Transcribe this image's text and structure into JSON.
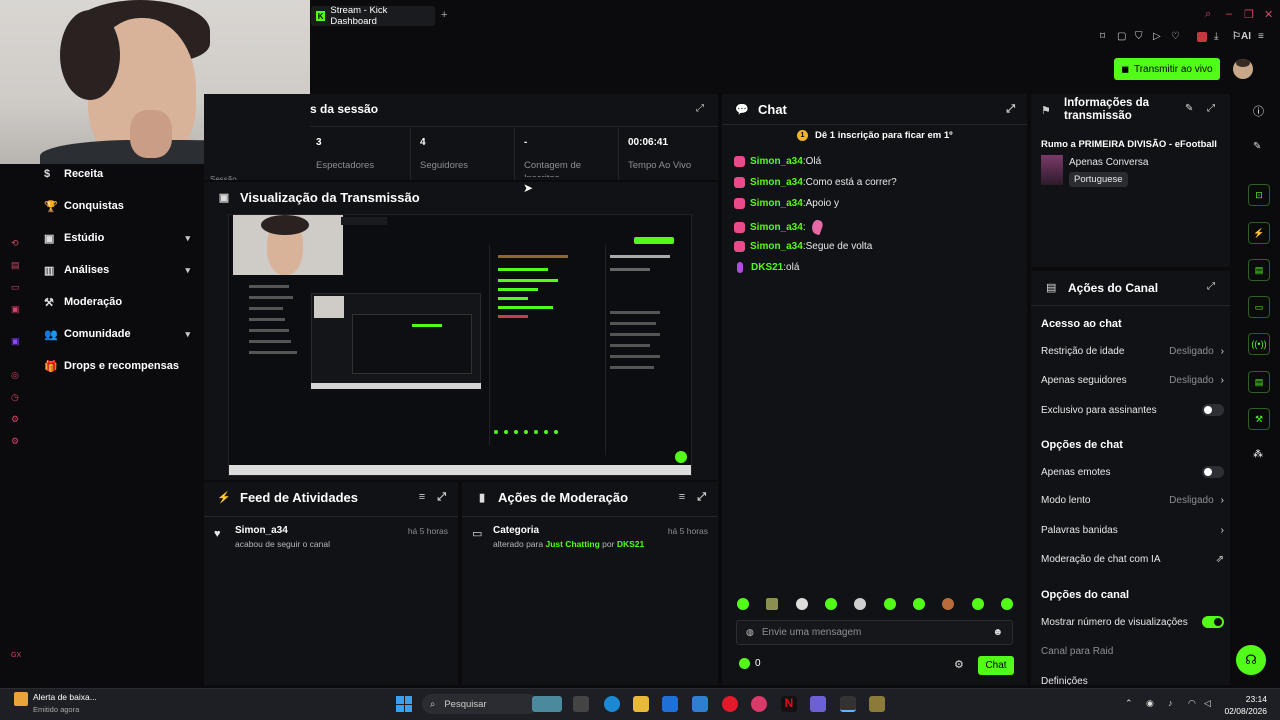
{
  "browser": {
    "tab_title": "Stream - Kick Dashboard",
    "tab_logo": "K",
    "new_tab_icon": "+"
  },
  "header": {
    "go_live_label": "Transmitir ao vivo",
    "ai_label": "AI"
  },
  "nav": {
    "items": [
      {
        "label": "Receita",
        "icon": "receipt-icon",
        "glyph": "$",
        "chev": ""
      },
      {
        "label": "Conquistas",
        "icon": "trophy-icon",
        "glyph": "🏆",
        "chev": ""
      },
      {
        "label": "Estúdio",
        "icon": "studio-icon",
        "glyph": "▣",
        "chev": "▾"
      },
      {
        "label": "Análises",
        "icon": "chart-icon",
        "glyph": "▥",
        "chev": "▾"
      },
      {
        "label": "Moderação",
        "icon": "gavel-icon",
        "glyph": "⚒",
        "chev": ""
      },
      {
        "label": "Comunidade",
        "icon": "community-icon",
        "glyph": "👥",
        "chev": "▾"
      },
      {
        "label": "Drops e recompensas",
        "icon": "gift-icon",
        "glyph": "🎁",
        "chev": ""
      }
    ]
  },
  "session": {
    "title_partial": "s da sessão",
    "truncated_label": "Sessão",
    "stats": [
      {
        "value": "3",
        "label": "Espectadores"
      },
      {
        "value": "4",
        "label": "Seguidores"
      },
      {
        "value": "-",
        "label": "Contagem de Inscritos"
      },
      {
        "value": "00:06:41",
        "label": "Tempo Ao Vivo"
      }
    ]
  },
  "preview": {
    "title": "Visualização da Transmissão"
  },
  "feed": {
    "title": "Feed de Atividades",
    "items": [
      {
        "user": "Simon_a34",
        "action": "acabou de seguir o canal",
        "time": "há 5 horas"
      }
    ]
  },
  "moderation": {
    "title": "Ações de Moderação",
    "items": [
      {
        "name": "Categoria",
        "prefix": "alterado para",
        "category": "Just Chatting",
        "by_word": "por",
        "by_user": "DKS21",
        "time": "há 5 horas"
      }
    ]
  },
  "chat": {
    "title": "Chat",
    "pinned_badge": "1",
    "pinned": "Dê 1 inscrição para ficar em 1º",
    "messages": [
      {
        "user": "Simon_a34",
        "text": "Olá"
      },
      {
        "user": "Simon_a34",
        "text": "Como está a correr?"
      },
      {
        "user": "Simon_a34",
        "text": "Apoio y"
      },
      {
        "user": "Simon_a34",
        "text": ""
      },
      {
        "user": "Simon_a34",
        "text": "Segue de volta"
      },
      {
        "user": "DKS21",
        "text": "olá"
      }
    ],
    "input_placeholder": "Envie uma mensagem",
    "points": "0",
    "send_label": "Chat"
  },
  "info": {
    "title_line1": "Informações da",
    "title_line2": "transmissão",
    "stream_title": "Rumo a PRIMEIRA DIVISÃO - eFootball",
    "category": "Apenas Conversa",
    "language": "Portuguese"
  },
  "channel_actions": {
    "title": "Ações do Canal",
    "chat_access": "Acesso ao chat",
    "age_restriction": "Restrição de idade",
    "age_value": "Desligado",
    "followers_only": "Apenas seguidores",
    "followers_value": "Desligado",
    "subs_only": "Exclusivo para assinantes",
    "chat_options": "Opções de chat",
    "emotes_only": "Apenas emotes",
    "slow_mode": "Modo lento",
    "slow_value": "Desligado",
    "banned_words": "Palavras banidas",
    "ai_moderation": "Moderação de chat com IA",
    "channel_options": "Opções do canal",
    "show_views": "Mostrar número de visualizações",
    "raid_channel": "Canal para Raid",
    "settings_partial": "Definições"
  },
  "taskbar": {
    "notification_title": "Alerta de baixa...",
    "notification_sub": "Emitido agora",
    "search_placeholder": "Pesquisar",
    "time": "23:14",
    "date": "02/08/2026"
  }
}
